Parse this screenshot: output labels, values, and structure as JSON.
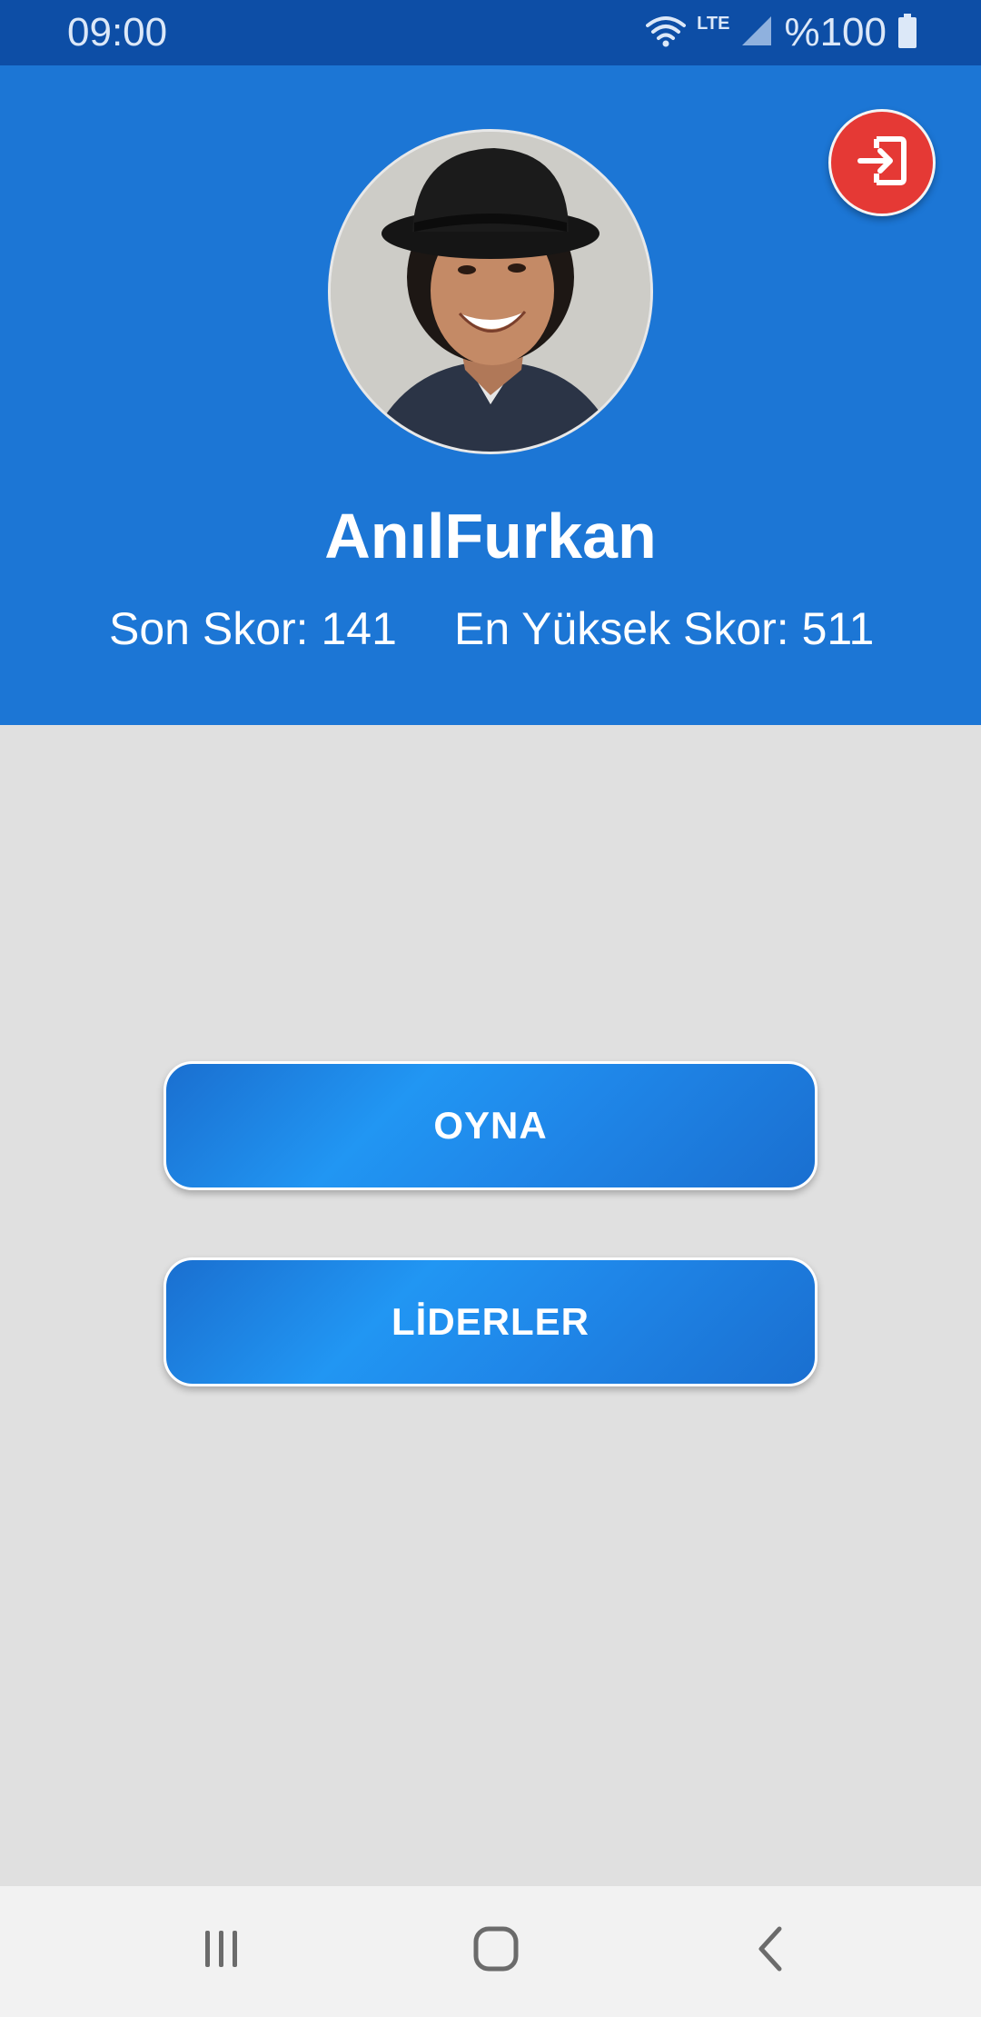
{
  "status_bar": {
    "time": "09:00",
    "network": "LTE",
    "battery": "%100",
    "icons": [
      "wifi-icon",
      "signal-icon",
      "battery-icon"
    ]
  },
  "header": {
    "user_name": "AnılFurkan",
    "last_score": "Son Skor: 141",
    "high_score": "En Yüksek Skor: 511",
    "avatar": "profile-avatar",
    "logout_icon": "logout-icon"
  },
  "buttons": {
    "play_label": "OYNA",
    "leaders_label": "LİDERLER"
  },
  "nav_bar": {
    "icons": [
      "recent-apps-icon",
      "home-icon",
      "back-icon"
    ]
  },
  "colors": {
    "status_bar": "#0d4ea6",
    "header": "#1c76d5",
    "background": "#e0e0e0",
    "logout": "#e53935",
    "button": "#1f86e8"
  }
}
